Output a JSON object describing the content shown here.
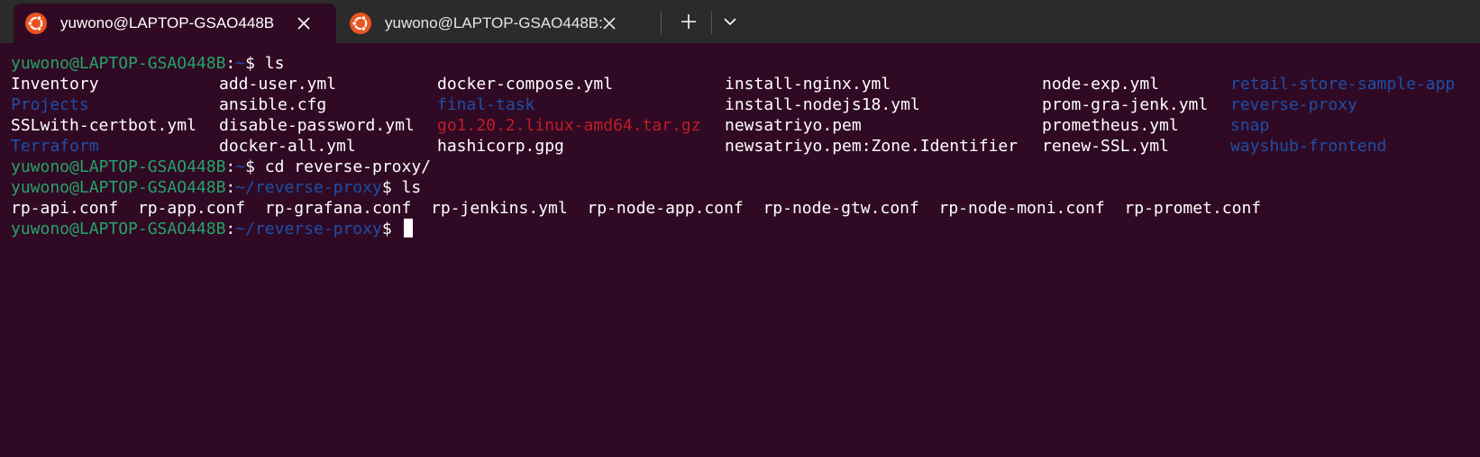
{
  "tabs": [
    {
      "title": "yuwono@LAPTOP-GSAO448B",
      "active": true
    },
    {
      "title": "yuwono@LAPTOP-GSAO448B:",
      "active": false
    }
  ],
  "toolbar": {
    "new_tab_symbol": "+",
    "dropdown_icon": "chevron-down-icon"
  },
  "colors": {
    "background": "#300a24",
    "titlebar": "#2b2b2b",
    "user": "#26a269",
    "directory": "#1d4fa8",
    "archive": "#c01c28",
    "text": "#ffffff",
    "tab_icon": "#e95420"
  },
  "prompt": {
    "user": "yuwono@LAPTOP-GSAO448B",
    "sep": ":",
    "home": "~",
    "path2": "~/reverse-proxy",
    "dollar": "$"
  },
  "commands": {
    "ls1": " ls",
    "cd": " cd reverse-proxy/",
    "ls2": " ls",
    "current": " "
  },
  "ls_home": [
    [
      "Inventory",
      "add-user.yml",
      "docker-compose.yml",
      "install-nginx.yml",
      "node-exp.yml",
      "retail-store-sample-app"
    ],
    [
      "Projects",
      "ansible.cfg",
      "final-task",
      "install-nodejs18.yml",
      "prom-gra-jenk.yml",
      "reverse-proxy"
    ],
    [
      "SSLwith-certbot.yml",
      "disable-password.yml",
      "go1.20.2.linux-amd64.tar.gz",
      "newsatriyo.pem",
      "prometheus.yml",
      "snap"
    ],
    [
      "Terraform",
      "docker-all.yml",
      "hashicorp.gpg",
      "newsatriyo.pem:Zone.Identifier",
      "renew-SSL.yml",
      "wayshub-frontend"
    ]
  ],
  "ls_reverse_proxy": "rp-api.conf  rp-app.conf  rp-grafana.conf  rp-jenkins.yml  rp-node-app.conf  rp-node-gtw.conf  rp-node-moni.conf  rp-promet.conf"
}
